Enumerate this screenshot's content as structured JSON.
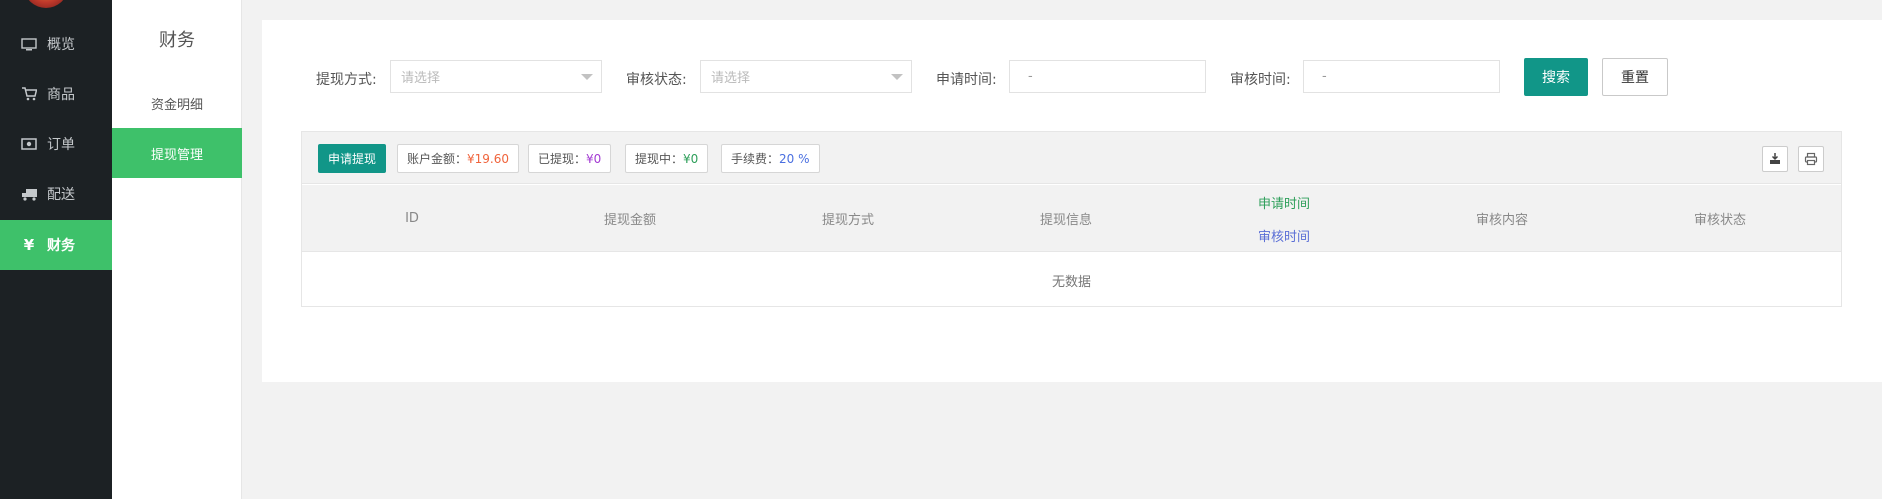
{
  "sidebar": {
    "items": [
      {
        "label": "概览",
        "icon": "monitor-icon"
      },
      {
        "label": "商品",
        "icon": "cart-icon"
      },
      {
        "label": "订单",
        "icon": "money-icon"
      },
      {
        "label": "配送",
        "icon": "truck-icon"
      },
      {
        "label": "财务",
        "icon": "yen-icon",
        "active": true
      }
    ]
  },
  "submenu": {
    "title": "财务",
    "items": [
      {
        "label": "资金明细"
      },
      {
        "label": "提现管理",
        "active": true
      }
    ]
  },
  "filters": {
    "withdraw_method": {
      "label": "提现方式:",
      "placeholder": "请选择"
    },
    "review_status": {
      "label": "审核状态:",
      "placeholder": "请选择"
    },
    "apply_time": {
      "label": "申请时间:",
      "value": "-"
    },
    "review_time": {
      "label": "审核时间:",
      "value": "-"
    },
    "search_label": "搜索",
    "reset_label": "重置"
  },
  "toolbar": {
    "apply_label": "申请提现",
    "stats": [
      {
        "label": "账户金额：",
        "value": "¥19.60",
        "color": "#f0643c"
      },
      {
        "label": "已提现：",
        "value": "¥0",
        "color": "#a33ad3"
      },
      {
        "label": "提现中：",
        "value": "¥0",
        "color": "#2e9f5a"
      },
      {
        "label": "手续费：",
        "value": "20 %",
        "color": "#4a6fe0"
      }
    ],
    "icons": [
      "export-icon",
      "print-icon"
    ]
  },
  "table": {
    "columns": [
      "ID",
      "提现金额",
      "提现方式",
      "提现信息",
      "申请时间",
      "审核内容",
      "审核状态"
    ],
    "time_column_line2": "审核时间",
    "empty_text": "无数据"
  },
  "colors": {
    "sidebar_bg": "#1c2124",
    "active_green": "#3ec16a",
    "primary_teal": "#119688"
  }
}
